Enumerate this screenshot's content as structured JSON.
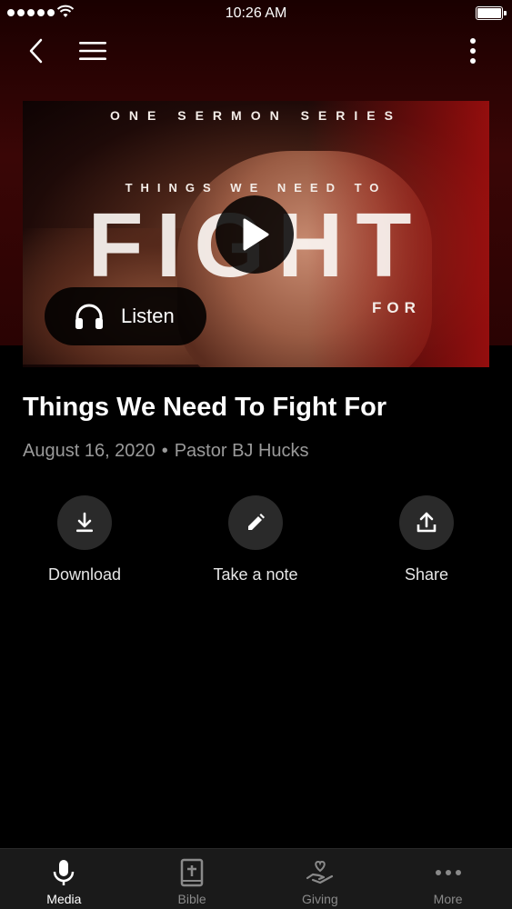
{
  "status_bar": {
    "time": "10:26 AM"
  },
  "nav": {
    "back_icon": "chevron-left-icon",
    "menu_icon": "hamburger-icon",
    "more_icon": "vertical-ellipsis-icon"
  },
  "media": {
    "artwork": {
      "series_text": "ONE SERMON SERIES",
      "subtitle_text": "THINGS WE NEED TO",
      "big_text": "FIGHT",
      "for_text": "FOR"
    },
    "play_icon": "play-icon",
    "listen_label": "Listen",
    "listen_icon": "headphones-icon"
  },
  "sermon": {
    "title": "Things We Need To Fight For",
    "date": "August 16, 2020",
    "separator": "•",
    "speaker": "Pastor BJ Hucks"
  },
  "actions": [
    {
      "label": "Download",
      "icon": "download-icon"
    },
    {
      "label": "Take a note",
      "icon": "pencil-icon"
    },
    {
      "label": "Share",
      "icon": "share-icon"
    }
  ],
  "tabs": [
    {
      "label": "Media",
      "icon": "microphone-icon",
      "active": true
    },
    {
      "label": "Bible",
      "icon": "bible-icon",
      "active": false
    },
    {
      "label": "Giving",
      "icon": "giving-hand-icon",
      "active": false
    },
    {
      "label": "More",
      "icon": "more-dots-icon",
      "active": false
    }
  ],
  "colors": {
    "background": "#000000",
    "header_red": "#3a0606",
    "action_circle": "#2a2a2a",
    "meta_text": "#9a9a9a",
    "tab_bar": "#1a1a1a"
  }
}
